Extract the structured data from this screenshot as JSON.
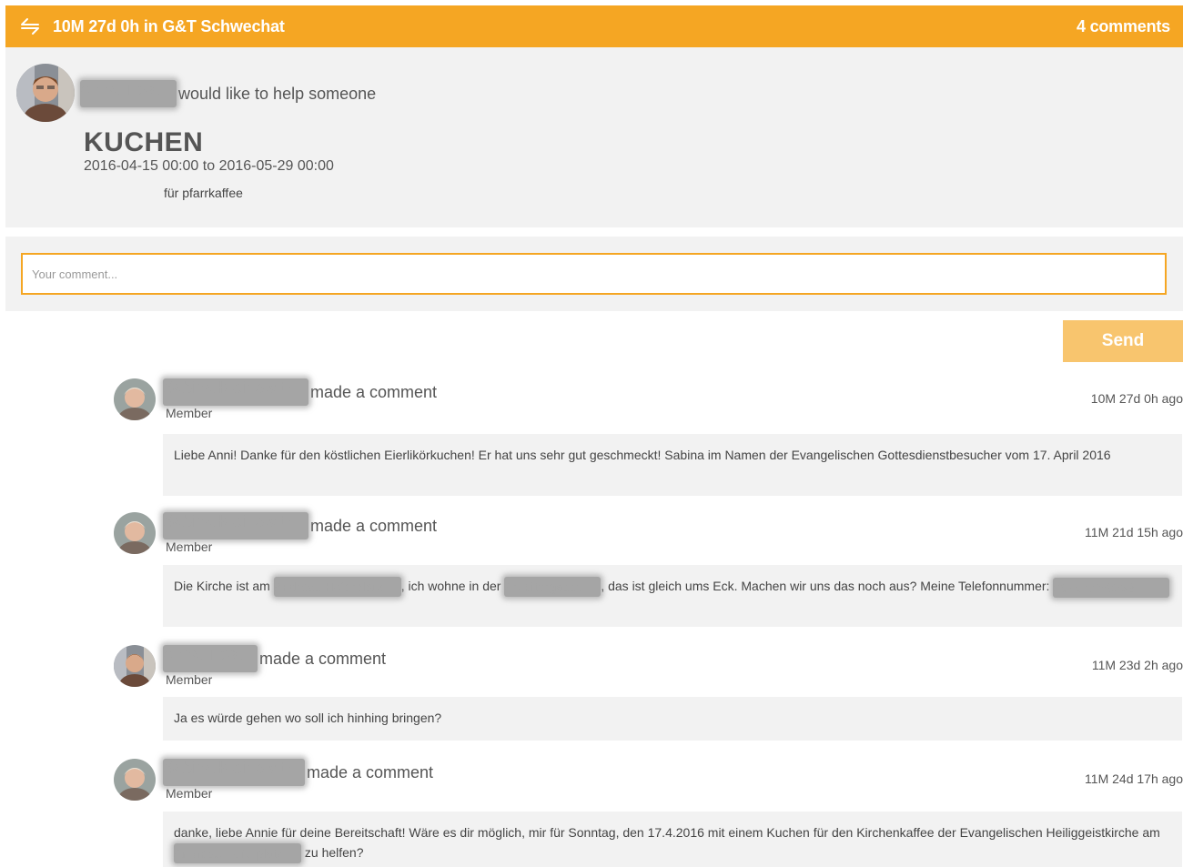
{
  "header": {
    "title": "10M 27d 0h in G&T Schwechat",
    "comments_count": "4 comments",
    "icon": "swap-arrows-icon",
    "color": "#f5a623"
  },
  "post": {
    "author": "Anna Tröstl",
    "action": "would like to help someone",
    "title": "KUCHEN",
    "dates": "2016-04-15 00:00 to 2016-05-29 00:00",
    "description": "für pfarrkaffee"
  },
  "comment_form": {
    "placeholder": "Your comment...",
    "send_label": "Send"
  },
  "comments": [
    {
      "author": "Sabina Kleinowitz",
      "action": "made a comment",
      "role": "Member",
      "time": "10M 27d 0h ago",
      "text": "Liebe Anni! Danke für den köstlichen Eierlikörkuchen! Er hat uns sehr gut geschmeckt! Sabina im Namen der Evangelischen Gottesdienstbesucher vom 17. April 2016"
    },
    {
      "author": "Sabina Kleinowitz",
      "action": "made a comment",
      "role": "Member",
      "time": "11M 21d 15h ago",
      "text_parts": [
        "Die Kirche ist am ",
        "Andreas Hoferplatz",
        ", ich wohne in der ",
        "Arbeitergasse",
        ", das ist gleich ums Eck. Machen wir uns das noch aus? Meine Telefonnummer: ",
        "0676 5258558"
      ]
    },
    {
      "author": "Anna Tröstl",
      "action": "made a comment",
      "role": "Member",
      "time": "11M 23d 2h ago",
      "text": "Ja es würde gehen wo soll ich hinhing bringen?"
    },
    {
      "author": "Sabina Kleinowitz",
      "action": "made a comment",
      "role": "Member",
      "time": "11M 24d 17h ago",
      "text_parts": [
        "danke, liebe Annie für deine Bereitschaft! Wäre es dir möglich, mir für Sonntag, den 17.4.2016 mit einem Kuchen für den Kirchenkaffee der Evangelischen Heiliggeistkirche am ",
        "Andreas Hoferplatz",
        " zu helfen?"
      ]
    }
  ]
}
